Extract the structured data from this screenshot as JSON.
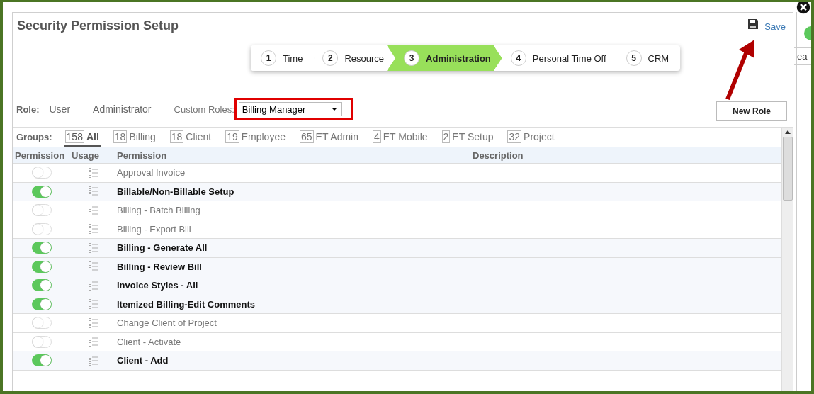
{
  "title": "Security Permission Setup",
  "save": {
    "label": "Save"
  },
  "steps": [
    {
      "number": "1",
      "label": "Time",
      "selected": false
    },
    {
      "number": "2",
      "label": "Resource",
      "selected": false
    },
    {
      "number": "3",
      "label": "Administration",
      "selected": true
    },
    {
      "number": "4",
      "label": "Personal Time Off",
      "selected": false
    },
    {
      "number": "5",
      "label": "CRM",
      "selected": false
    }
  ],
  "role": {
    "label": "Role:",
    "options": [
      {
        "label": "User",
        "selected": false
      },
      {
        "label": "Administrator",
        "selected": false
      }
    ],
    "custom_label": "Custom Roles:",
    "custom_value": "Billing Manager"
  },
  "new_role_button": "New Role",
  "groups": {
    "label": "Groups:",
    "items": [
      {
        "count": "158",
        "label": "All",
        "selected": true
      },
      {
        "count": "18",
        "label": "Billing",
        "selected": false
      },
      {
        "count": "18",
        "label": "Client",
        "selected": false
      },
      {
        "count": "19",
        "label": "Employee",
        "selected": false
      },
      {
        "count": "65",
        "label": "ET Admin",
        "selected": false
      },
      {
        "count": "4",
        "label": "ET Mobile",
        "selected": false
      },
      {
        "count": "2",
        "label": "ET Setup",
        "selected": false
      },
      {
        "count": "32",
        "label": "Project",
        "selected": false
      }
    ]
  },
  "table": {
    "columns": [
      "Permission",
      "Usage",
      "Permission",
      "Description"
    ],
    "rows": [
      {
        "name": "Approval Invoice",
        "on": false
      },
      {
        "name": "Billable/Non-Billable Setup",
        "on": true
      },
      {
        "name": "Billing - Batch Billing",
        "on": false
      },
      {
        "name": "Billing - Export Bill",
        "on": false
      },
      {
        "name": "Billing - Generate All",
        "on": true
      },
      {
        "name": "Billing - Review Bill",
        "on": true
      },
      {
        "name": "Invoice Styles - All",
        "on": true
      },
      {
        "name": "Itemized Billing-Edit Comments",
        "on": true
      },
      {
        "name": "Change Client of Project",
        "on": false
      },
      {
        "name": "Client - Activate",
        "on": false
      },
      {
        "name": "Client - Add",
        "on": true
      }
    ]
  },
  "background_fragment": "ea"
}
